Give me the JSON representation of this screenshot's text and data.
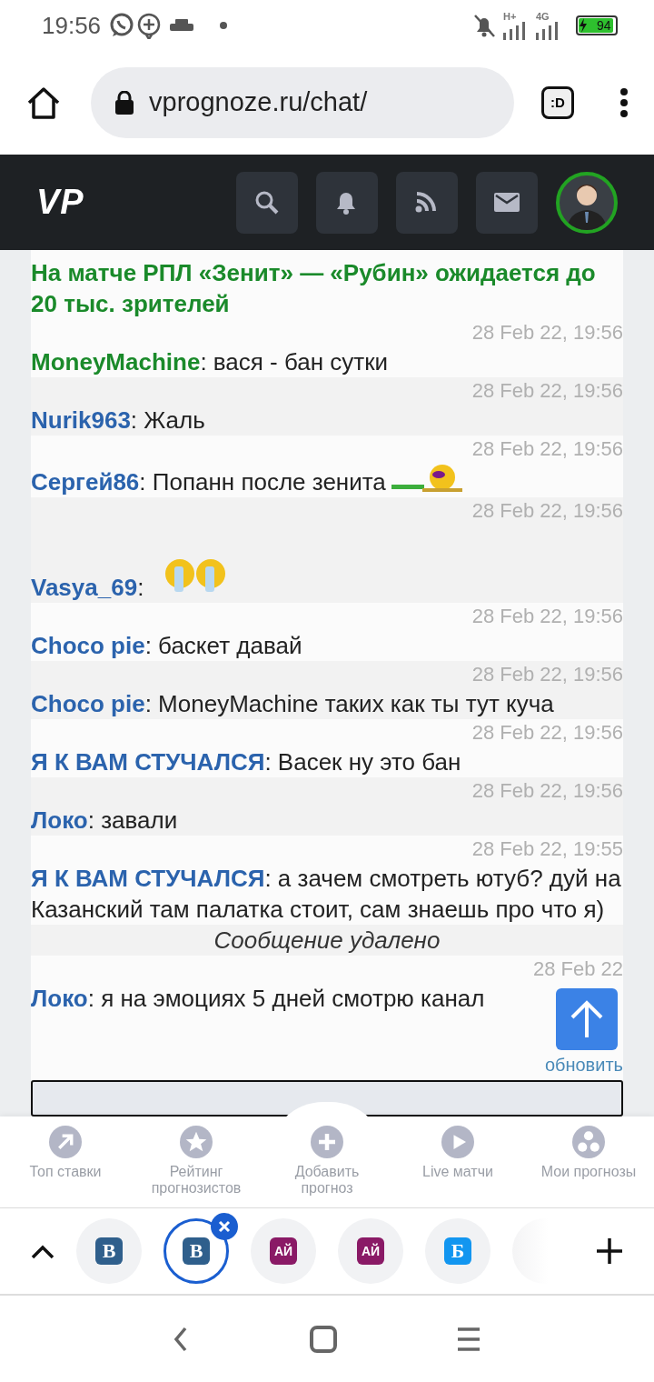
{
  "status_bar": {
    "time": "19:56",
    "network_labels": [
      "H+",
      "4G"
    ],
    "battery": "94",
    "charging": true
  },
  "browser": {
    "url": "vprognoze.ru/chat/",
    "extension_label": ":D"
  },
  "site_header": {
    "logo": "VP"
  },
  "chat": {
    "headline": "На матче РПЛ «Зенит» — «Рубин» ожидается до 20 тыс. зрителей",
    "messages": [
      {
        "kind": "text",
        "time": "28 Feb 22, 19:56",
        "author": "MoneyMachine",
        "color": "#1a8a2a",
        "text": ": вася - бан сутки"
      },
      {
        "kind": "text",
        "time": "28 Feb 22, 19:56",
        "author": "Nurik963",
        "color": "#2b63ad",
        "text": ": Жаль"
      },
      {
        "kind": "text_emoticon",
        "time": "28 Feb 22, 19:56",
        "author": "Сергей86",
        "color": "#2b63ad",
        "text": ": Попанн после зенита"
      },
      {
        "kind": "emoticon",
        "time": "28 Feb 22, 19:56",
        "author": "Vasya_69",
        "color": "#2b63ad",
        "text": ":"
      },
      {
        "kind": "text",
        "time": "28 Feb 22, 19:56",
        "author": "Choco pie",
        "color": "#2b63ad",
        "text": ": баскет давай"
      },
      {
        "kind": "text",
        "time": "28 Feb 22, 19:56",
        "author": "Choco pie",
        "color": "#2b63ad",
        "text": ": MoneyMachine таких как ты тут куча"
      },
      {
        "kind": "text",
        "time": "28 Feb 22, 19:56",
        "author": "Я К ВАМ СТУЧАЛСЯ",
        "color": "#2b63ad",
        "text": ": Васек ну это бан"
      },
      {
        "kind": "text",
        "time": "28 Feb 22, 19:56",
        "author": "Локо",
        "color": "#2b63ad",
        "text": ": завали"
      },
      {
        "kind": "text",
        "time": "28 Feb 22, 19:55",
        "author": "Я К ВАМ СТУЧАЛСЯ",
        "color": "#2b63ad",
        "text": ": а зачем смотреть ютуб? дуй на Казанский там палатка стоит, сам знаешь про что я)"
      },
      {
        "kind": "deleted",
        "text": "Сообщение удалено"
      },
      {
        "kind": "text",
        "time": "28 Feb 22",
        "author": "Локо",
        "color": "#2b63ad",
        "text": ": я на эмоциях 5 дней смотрю канал"
      }
    ],
    "refresh_link": "обновить"
  },
  "bottom_nav": [
    {
      "label": "Топ ставки"
    },
    {
      "label": "Рейтинг прогнозистов"
    },
    {
      "label": "Добавить прогноз"
    },
    {
      "label": "Live матчи"
    },
    {
      "label": "Мои прогнозы"
    }
  ],
  "tabs": [
    {
      "favicon": "B",
      "color": "#2f5f8c",
      "selected": false
    },
    {
      "favicon": "B",
      "color": "#2f5f8c",
      "selected": true
    },
    {
      "favicon": "АЙ",
      "color": "#8a1a66",
      "selected": false
    },
    {
      "favicon": "АЙ",
      "color": "#8a1a66",
      "selected": false
    },
    {
      "favicon": "Б",
      "color": "#1296f0",
      "selected": false
    }
  ]
}
